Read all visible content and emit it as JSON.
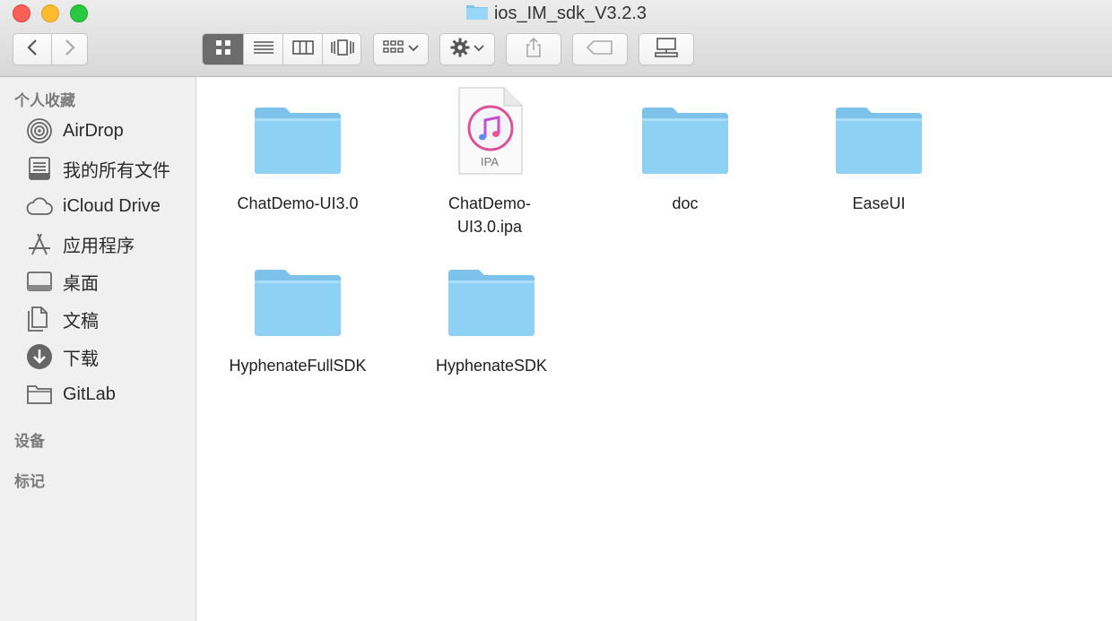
{
  "window": {
    "title": "ios_IM_sdk_V3.2.3"
  },
  "toolbar": {
    "back_icon": "chevron-left-icon",
    "forward_icon": "chevron-right-icon",
    "view_modes": [
      "icon-view",
      "list-view",
      "column-view",
      "cover-flow-view"
    ],
    "active_view": "icon-view",
    "arrange_icon": "arrange-grid-icon",
    "action_icon": "gear-icon",
    "share_icon": "share-icon",
    "tag_icon": "tag-icon",
    "connect_icon": "network-drive-icon"
  },
  "sidebar": {
    "favorites_heading": "个人收藏",
    "items": [
      {
        "label": "AirDrop",
        "icon": "airdrop-icon"
      },
      {
        "label": "我的所有文件",
        "icon": "all-files-icon"
      },
      {
        "label": "iCloud Drive",
        "icon": "cloud-icon"
      },
      {
        "label": "应用程序",
        "icon": "applications-icon"
      },
      {
        "label": "桌面",
        "icon": "desktop-icon"
      },
      {
        "label": "文稿",
        "icon": "documents-icon"
      },
      {
        "label": "下载",
        "icon": "download-icon"
      },
      {
        "label": "GitLab",
        "icon": "folder-icon"
      }
    ],
    "devices_heading": "设备",
    "tags_heading": "标记"
  },
  "files": [
    {
      "name": "ChatDemo-UI3.0",
      "kind": "folder"
    },
    {
      "name_line1": "ChatDemo-",
      "name_line2": "UI3.0.ipa",
      "kind": "ipa",
      "badge": "IPA"
    },
    {
      "name": "doc",
      "kind": "folder"
    },
    {
      "name": "EaseUI",
      "kind": "folder"
    },
    {
      "name": "HyphenateFullSDK",
      "kind": "folder"
    },
    {
      "name": "HyphenateSDK",
      "kind": "folder"
    }
  ],
  "colors": {
    "folder": "#8fd0f5",
    "folder_tab": "#7cc2ea",
    "selected_segment": "#6c6c6c"
  }
}
